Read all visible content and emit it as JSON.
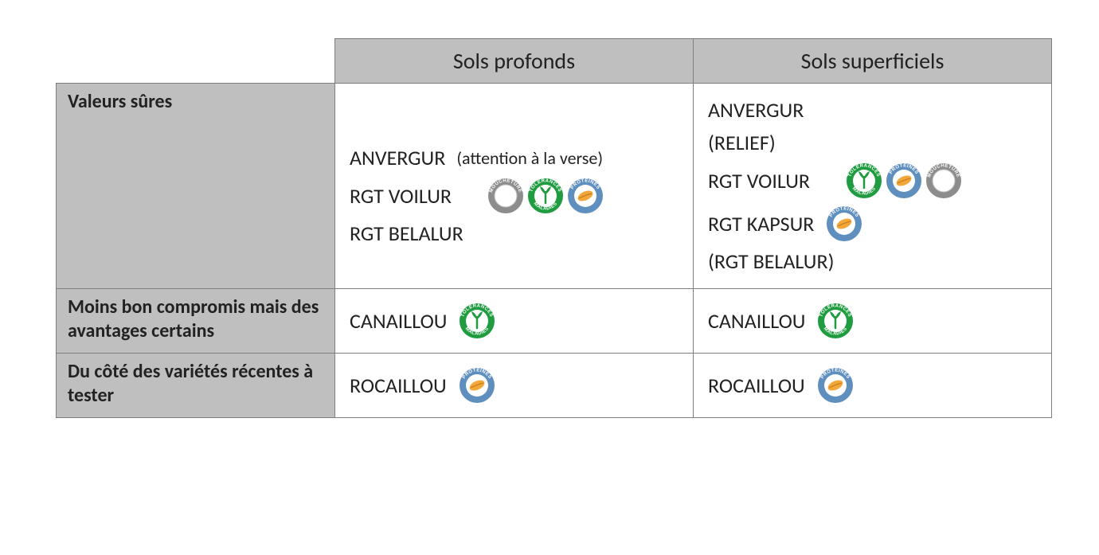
{
  "columns": [
    "Sols profonds",
    "Sols superficiels"
  ],
  "rows": [
    {
      "label": "Valeurs sûres",
      "profonds": [
        {
          "text": "ANVERGUR",
          "note": "(attention à la verse)"
        },
        {
          "text": "RGT VOILUR",
          "badges": [
            "moucheture",
            "tolerances",
            "proteines"
          ],
          "badges_shift": true
        },
        {
          "text": "RGT BELALUR"
        }
      ],
      "superficiels": [
        {
          "text": "ANVERGUR"
        },
        {
          "text": "(RELIEF)"
        },
        {
          "text": "RGT VOILUR",
          "badges": [
            "tolerances",
            "proteines",
            "moucheture"
          ],
          "badges_shift": true
        },
        {
          "text": "RGT KAPSUR",
          "badges": [
            "proteines"
          ]
        },
        {
          "text": "(RGT BELALUR)"
        }
      ]
    },
    {
      "label": "Moins bon compromis mais des avantages certains",
      "profonds": [
        {
          "text": "CANAILLOU",
          "badges": [
            "tolerances"
          ]
        }
      ],
      "superficiels": [
        {
          "text": "CANAILLOU",
          "badges": [
            "tolerances"
          ]
        }
      ]
    },
    {
      "label": "Du côté des variétés récentes à tester",
      "profonds": [
        {
          "text": "ROCAILLOU",
          "badges": [
            "proteines"
          ]
        }
      ],
      "superficiels": [
        {
          "text": "ROCAILLOU",
          "badges": [
            "proteines"
          ]
        }
      ]
    }
  ],
  "badge_labels": {
    "moucheture": "MOUCHETURE",
    "tolerances": "TOLERANCES MALADIES",
    "proteines": "PROTEINES"
  }
}
